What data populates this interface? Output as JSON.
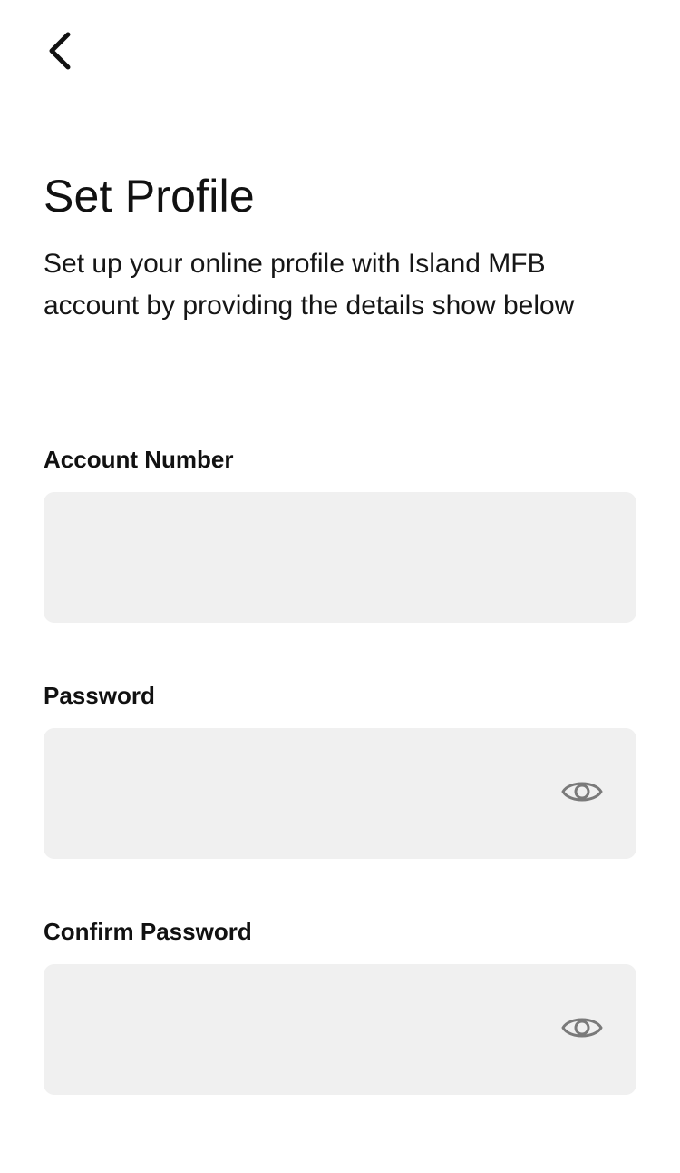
{
  "header": {
    "back_icon": "chevron-left-icon"
  },
  "page": {
    "title": "Set Profile",
    "subtitle": "Set up your online profile with Island MFB account by providing the details show below"
  },
  "form": {
    "account_number": {
      "label": "Account Number",
      "value": "",
      "placeholder": ""
    },
    "password": {
      "label": "Password",
      "value": "",
      "placeholder": "",
      "toggle_icon": "eye-icon"
    },
    "confirm_password": {
      "label": "Confirm Password",
      "value": "",
      "placeholder": "",
      "toggle_icon": "eye-icon"
    }
  },
  "colors": {
    "background": "#ffffff",
    "field_background": "#f0f0f0",
    "text": "#111111",
    "icon": "#7a7a7a"
  }
}
